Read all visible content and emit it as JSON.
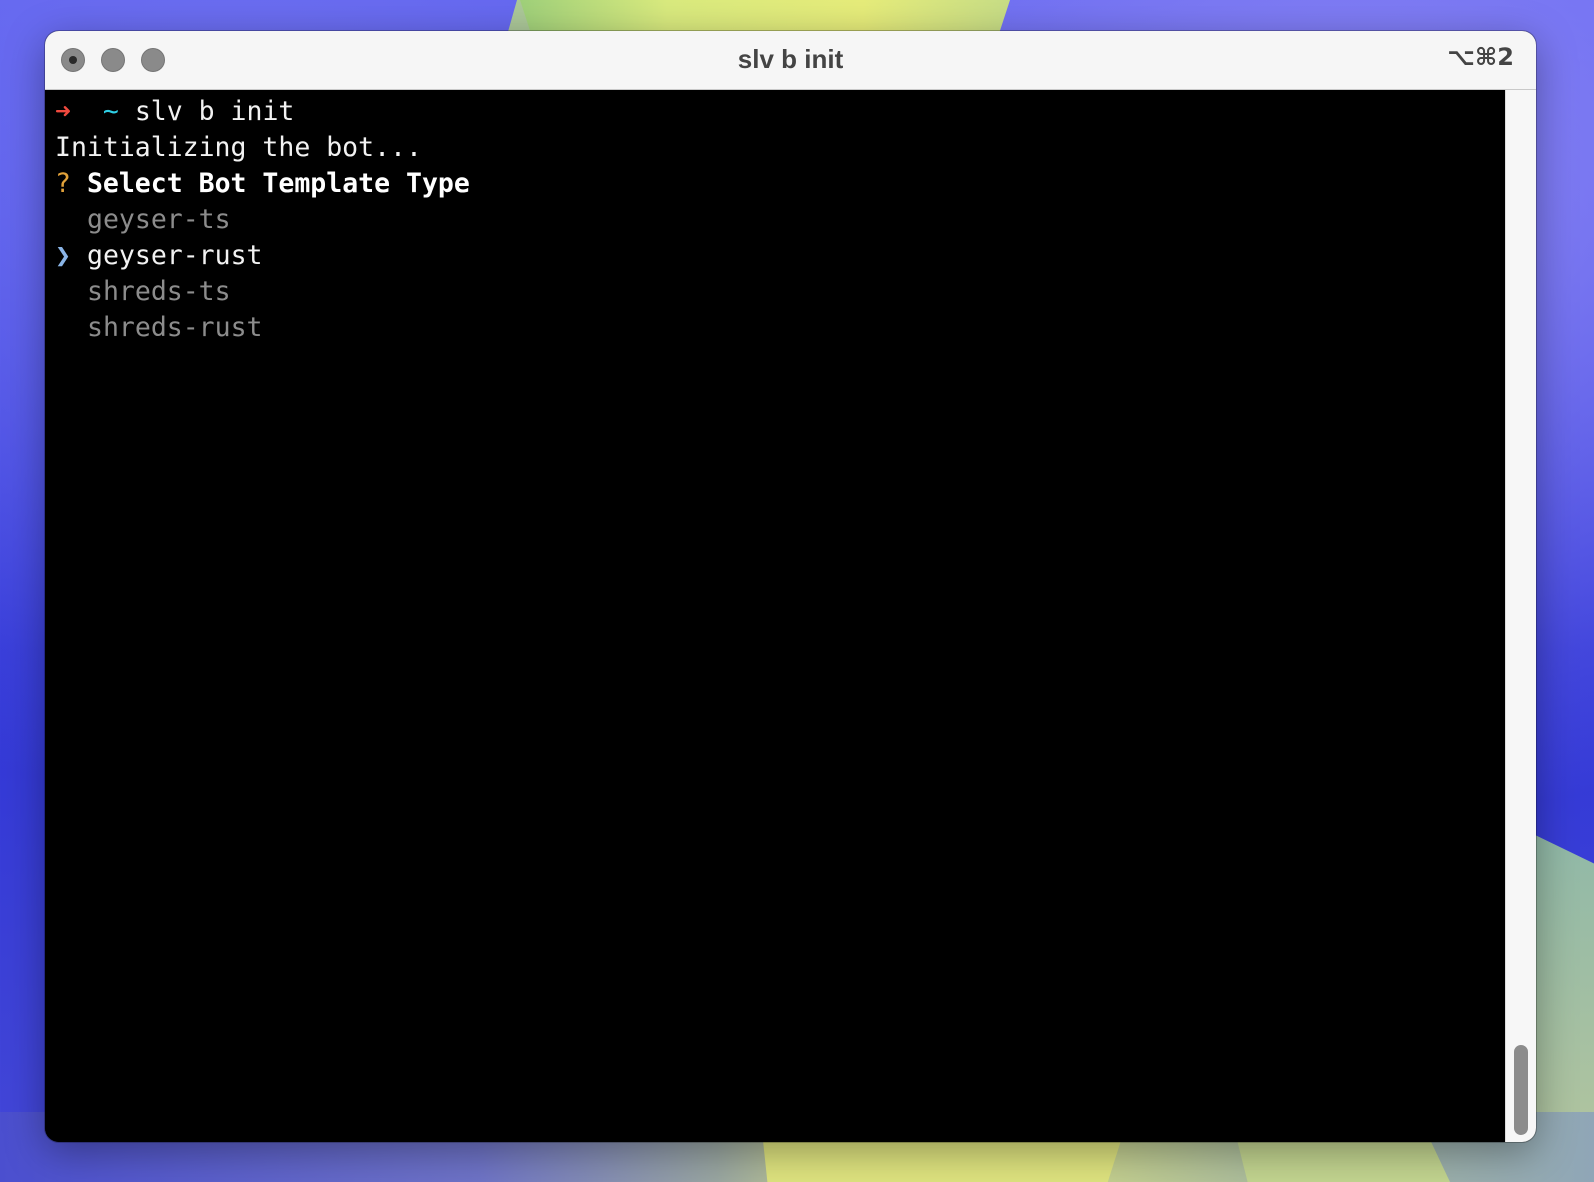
{
  "window": {
    "title": "slv b init",
    "shortcut": "⌥⌘2"
  },
  "terminal": {
    "prompt_arrow": "➜",
    "prompt_dir": "~",
    "command": "slv b init",
    "status": "Initializing the bot...",
    "question_mark": "?",
    "question": "Select Bot Template Type",
    "pointer": "❯",
    "options": [
      {
        "label": "geyser-ts",
        "selected": false
      },
      {
        "label": "geyser-rust",
        "selected": true
      },
      {
        "label": "shreds-ts",
        "selected": false
      },
      {
        "label": "shreds-rust",
        "selected": false
      }
    ]
  },
  "colors": {
    "prompt_arrow": "#f0493e",
    "prompt_dir": "#2fd0e6",
    "question_mark": "#e2a23a",
    "pointer": "#8ab4e6",
    "unselected_option": "#8c8c8c"
  }
}
